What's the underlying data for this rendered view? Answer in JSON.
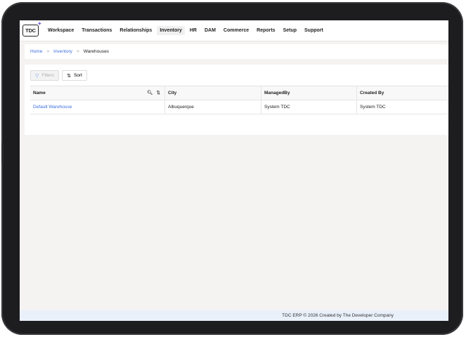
{
  "app": {
    "logo_text": "TDC",
    "menu": [
      {
        "label": "Workspace"
      },
      {
        "label": "Transactions"
      },
      {
        "label": "Relationships"
      },
      {
        "label": "Inventory"
      },
      {
        "label": "HR"
      },
      {
        "label": "DAM"
      },
      {
        "label": "Commerce"
      },
      {
        "label": "Reports"
      },
      {
        "label": "Setup"
      },
      {
        "label": "Support"
      }
    ],
    "active_menu": "Inventory"
  },
  "breadcrumb": {
    "items": [
      "Home",
      "Inventory"
    ],
    "current": "Warehouses",
    "separator": ">"
  },
  "toolbar": {
    "filters_label": "Filters",
    "sort_label": "Sort"
  },
  "table": {
    "columns": [
      "Name",
      "City",
      "ManagedBy",
      "Created By"
    ],
    "rows": [
      [
        "Default Warehouse",
        "Albuquerque",
        "System TDC",
        "System TDC"
      ]
    ]
  },
  "footer": {
    "text": "TDC ERP © 2026 Created by The Developer Company"
  },
  "colors": {
    "link": "#3d6fe0",
    "active_menu_bg": "#f0f0f0",
    "footer_bg": "#e9f0fa",
    "device_frame": "#1d1d1f"
  }
}
